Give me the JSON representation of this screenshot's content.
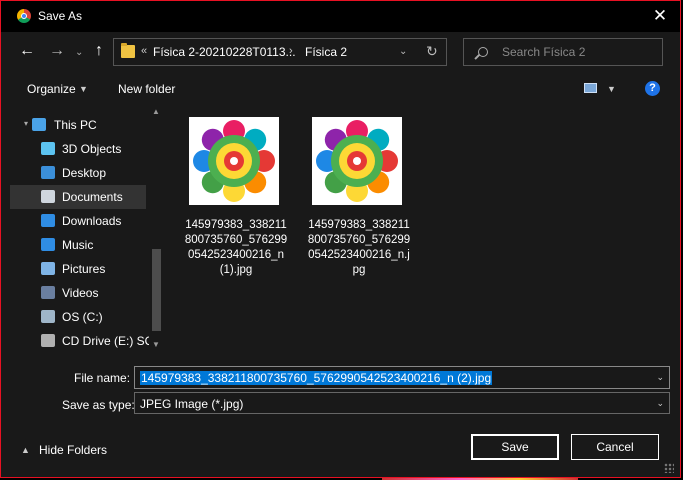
{
  "window": {
    "title": "Save As",
    "close_symbol": "✕"
  },
  "nav": {
    "back_symbol": "←",
    "forward_symbol": "→",
    "recent_symbol": "⌄",
    "up_symbol": "↑",
    "breadcrumb": [
      "Física 2-20210228T0113...",
      "Física 2"
    ],
    "refresh_symbol": "↻",
    "search_placeholder": "Search Física 2"
  },
  "toolbar": {
    "organize_label": "Organize",
    "new_folder_label": "New folder",
    "help_label": "?"
  },
  "sidebar": {
    "items": [
      {
        "label": "This PC",
        "icon": "this-pc-icon",
        "root": true,
        "selected": false
      },
      {
        "label": "3D Objects",
        "icon": "3d-objects-icon",
        "selected": false
      },
      {
        "label": "Desktop",
        "icon": "desktop-icon",
        "selected": false
      },
      {
        "label": "Documents",
        "icon": "documents-icon",
        "selected": true
      },
      {
        "label": "Downloads",
        "icon": "downloads-icon",
        "selected": false
      },
      {
        "label": "Music",
        "icon": "music-icon",
        "selected": false
      },
      {
        "label": "Pictures",
        "icon": "pictures-icon",
        "selected": false
      },
      {
        "label": "Videos",
        "icon": "videos-icon",
        "selected": false
      },
      {
        "label": "OS (C:)",
        "icon": "drive-c-icon",
        "selected": false
      },
      {
        "label": "CD Drive (E:) SQL",
        "icon": "cd-drive-icon",
        "selected": false
      }
    ]
  },
  "files": [
    {
      "name": "145979383_338211800735760_5762990542523400216_n (1).jpg"
    },
    {
      "name": "145979383_338211800735760_5762990542523400216_n.jpg"
    }
  ],
  "form": {
    "file_name_label": "File name:",
    "file_name_value": "145979383_338211800735760_5762990542523400216_n (2).jpg",
    "save_type_label": "Save as type:",
    "save_type_value": "JPEG Image (*.jpg)",
    "hide_folders_label": "Hide Folders",
    "save_label": "Save",
    "cancel_label": "Cancel"
  },
  "colors": {
    "accent": "#0078d7",
    "border": "#e81123",
    "background": "#191919"
  }
}
